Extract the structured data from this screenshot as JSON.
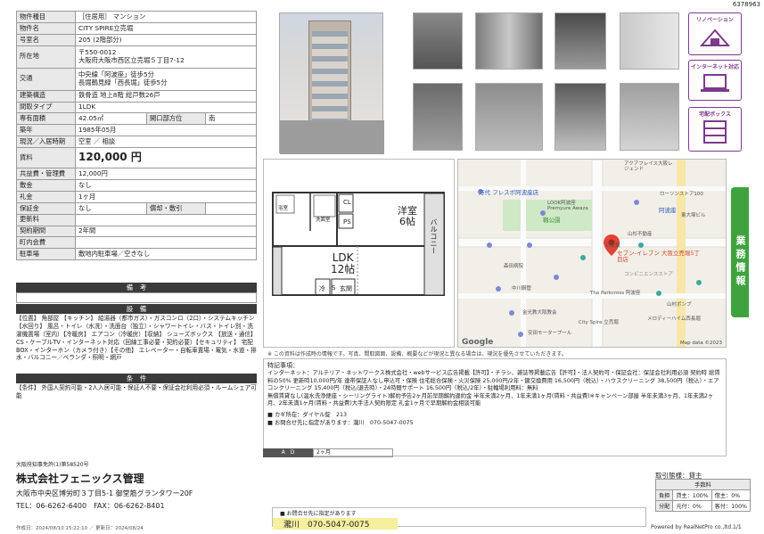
{
  "doc_id": "6378963",
  "property": {
    "rows": [
      {
        "label": "物件種目",
        "value": "［住居用］ マンション"
      },
      {
        "label": "物件名",
        "value": "CITY SPIRE立売堀"
      },
      {
        "label": "号室名",
        "value": "205 (2階部分)"
      },
      {
        "label": "所在地",
        "value": "〒550-0012\n大阪府大阪市西区立売堀５丁目7-12"
      },
      {
        "label": "交通",
        "value": "中央線「阿波座」徒歩5分\n長堀鶴見緑「西長堀」徒歩5分"
      },
      {
        "label": "建築構造",
        "value": "鉄骨造 地上8階 総戸数26戸"
      },
      {
        "label": "間取タイプ",
        "value": "1LDK"
      },
      {
        "label": "専有面積",
        "value": "42.05㎡",
        "label2": "開口部方位",
        "value2": "南"
      },
      {
        "label": "築年",
        "value": "1985年05月"
      },
      {
        "label": "現況／入居時期",
        "value": "空室 ／ 相談"
      },
      {
        "label": "賃料",
        "value": "120,000 円"
      },
      {
        "label": "共益費・管理費",
        "value": "12,000円"
      },
      {
        "label": "敷金",
        "value": "なし"
      },
      {
        "label": "礼金",
        "value": "1ヶ月"
      },
      {
        "label": "保証金",
        "value": "なし",
        "label2": "償却・敷引",
        "value2": ""
      },
      {
        "label": "更新料",
        "value": ""
      },
      {
        "label": "契約期間",
        "value": "2年間"
      },
      {
        "label": "町内会費",
        "value": ""
      },
      {
        "label": "駐車場",
        "value": "敷地内駐車場／空きなし"
      }
    ]
  },
  "sections": {
    "remarks_header": "備　考",
    "facilities_header": "設　備",
    "facilities_text": "【位置】 角部屋 【キッチン】 給湯器（都市ガス）・ガスコンロ（2口）・システムキッチン【水回り】 風呂・トイレ（水洗）・洗面台（独立）・シャワートイレ・バス・トイレ別・洗濯機置場（室内）【冷暖房】 エアコン（冷暖房）【収納】 シューズボックス 【放送・通信】 CS・ケーブルTV・インターネット対応（回線工事必要・契約必要）【セキュリティ】 宅配BOX・インターホン（カメラ付き）【その他】 エレベーター・自転車置場・電気・水道・排水・バルコニー／ベランダ・照明・網戸",
    "conditions_header": "条　件",
    "conditions_text": "【条件】 外国人契約可能・2人入居可能・保証人不要・保証会社利用必須・ルームシェア可能"
  },
  "badges": [
    {
      "text": "リノベーション",
      "icon": "renovation-icon"
    },
    {
      "text": "インターネット対応",
      "icon": "laptop-icon"
    },
    {
      "text": "宅配ボックス",
      "icon": "delivery-box-icon"
    }
  ],
  "green_tab": "業務情報",
  "floorplan": {
    "rooms": [
      "洋室",
      "6帖",
      "LDK",
      "12帖"
    ],
    "labels": [
      "CL",
      "PS",
      "冷",
      "S",
      "玄関",
      "洗面室",
      "浴室",
      "バルコニー"
    ]
  },
  "map": {
    "attribution": "Map data ©2023",
    "google": "Google",
    "places": [
      "万代 フレスポ阿波座店",
      "LOOK阿波座",
      "Premyure Awaza",
      "阿波座",
      "靱公園",
      "セブン-イレブン 大阪立売堀5丁目店",
      "コンビニエンスストア",
      "森田病院",
      "中川鋼管",
      "The Parkcross 阿波座",
      "金光教大阪教会",
      "City Spire 立売堀",
      "安田モータープール",
      "メロディーハイム西長堀",
      "日鉄鋼",
      "ローソンストア100",
      "山杉不動産",
      "東大塚ビル",
      "アクアフレイス大阪レジェンド",
      "山村ボンプ"
    ]
  },
  "map_note": "※ この資料は作成時の情報です。写真、間取図面、設備、概要などが現況と異なる場合は、現況を優先させていただきます。",
  "features": {
    "title": "特記事項：",
    "text": "インターネット：アルテリア・ネットワークス株式会社・webサービス広告掲載【許可】・チラシ、雑誌等掲載広告【許可】・法人契約可・保証会社：保証会社利用必須 契約時 総賃料の50% 更新時10,000円/年 連帯保証人なし申込可・保険 住宅総合保険・火災保険 25,000円/2年・鍵交換費用 16,500円（税込）・ハウスクリーニング 38,500円（税込）・エアコンクリーニング 15,400円（税込/退去時）・24時間サポート 16,500円（税込/2年）・駐輪場利用料：無料\n無償賃貸なし(温水洗浄便座・シーリングライト)解約予告2ヶ月前早期解約違約金 半年未満2ヶ月、1年未満1ヶ月(賃料・共益費)※キャンペーン部屋 半年未満3ヶ月、1年未満2ヶ月、2年未満1ヶ月(賃料・共益費)大手法人契約限定 礼金1ヶ月で早期解約金相談可能",
    "key": "■ カギ所在：ダイヤル錠　213",
    "contact": "■ お問合せ先に指定があります：瀧川　070-5047-0075"
  },
  "ad": {
    "label": "A　D",
    "value": "2ヶ月"
  },
  "contact_bar": {
    "title": "■ お問合せ先に指定があります",
    "value": "瀧川　070-5047-0075"
  },
  "company": {
    "license": "大阪府知事免許(1)第58520号",
    "name": "株式会社フェニックス管理",
    "address": "大阪市中央区博労町３丁目5-1 御堂筋グランタワー20F",
    "tel": "TEL：06-6262-6400　FAX：06-6262-8401"
  },
  "deal": {
    "title": "取引態様：貸主",
    "fee_header": "手数料",
    "rows": [
      {
        "label": "負担",
        "v1": "貸主：100%",
        "v2": "借主：0%"
      },
      {
        "label": "分配",
        "v1": "元付：0%",
        "v2": "客付：100%"
      }
    ]
  },
  "footer": {
    "printed": "作成日：2024/08/10 15:22:10 ／ 更新日：2024/08/24",
    "powered": "Powered by RealNetPro co.,ltd.",
    "page": "1/1"
  }
}
